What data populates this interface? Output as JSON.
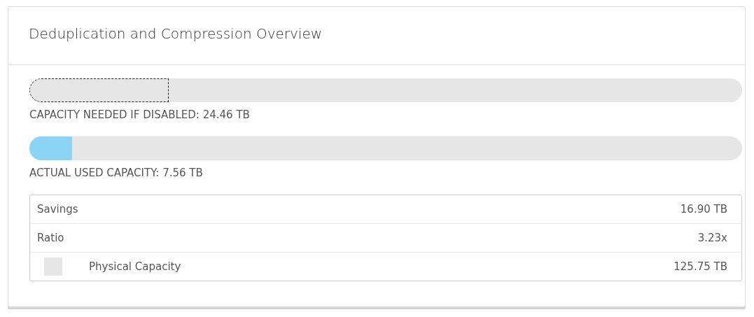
{
  "card": {
    "title": "Deduplication and Compression Overview"
  },
  "bars": [
    {
      "kind": "outline",
      "level": 0.195,
      "label": "CAPACITY NEEDED IF DISABLED: 24.46 TB"
    },
    {
      "kind": "filled",
      "level": 0.06,
      "label": "ACTUAL USED CAPACITY: 7.56 TB"
    }
  ],
  "table": {
    "rows": [
      {
        "kind": "plain",
        "label": "Savings",
        "value": "16.90 TB"
      },
      {
        "kind": "plain",
        "label": "Ratio",
        "value": "3.23x"
      },
      {
        "kind": "legend",
        "color": "#e6e6e6",
        "label": "Physical Capacity",
        "value": "125.75 TB"
      }
    ]
  }
}
